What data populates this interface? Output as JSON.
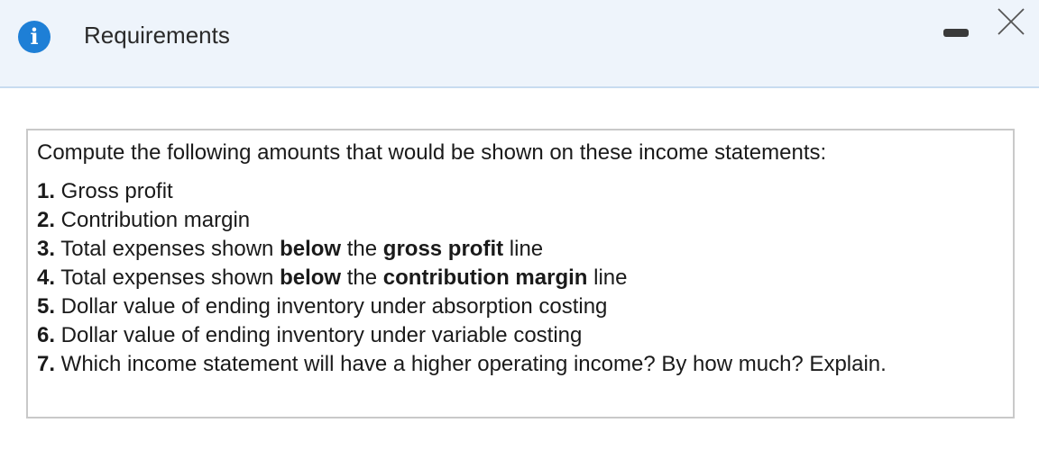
{
  "dialog": {
    "title": "Requirements",
    "icons": {
      "info": "info-icon",
      "minimize": "minimize-icon",
      "close": "close-icon"
    },
    "info_glyph": "i"
  },
  "content": {
    "intro": "Compute the following amounts that would be shown on these income statements:",
    "items": [
      {
        "num": "1.",
        "text": " Gross profit"
      },
      {
        "num": "2.",
        "text": " Contribution margin"
      },
      {
        "num": "3.",
        "t1": " Total expenses shown ",
        "b1": "below",
        "t2": " the ",
        "b2": "gross profit",
        "t3": " line"
      },
      {
        "num": "4.",
        "t1": " Total expenses shown ",
        "b1": "below",
        "t2": " the ",
        "b2": "contribution margin",
        "t3": " line"
      },
      {
        "num": "5.",
        "text": " Dollar value of ending inventory under absorption costing"
      },
      {
        "num": "6.",
        "text": " Dollar value of ending inventory under variable costing"
      },
      {
        "num": "7.",
        "text": " Which income statement will have a higher operating income? By how much? Explain."
      }
    ]
  },
  "colors": {
    "header_bg": "#eef4fb",
    "info_icon": "#1e7fd6",
    "border": "#c9c9c9"
  }
}
